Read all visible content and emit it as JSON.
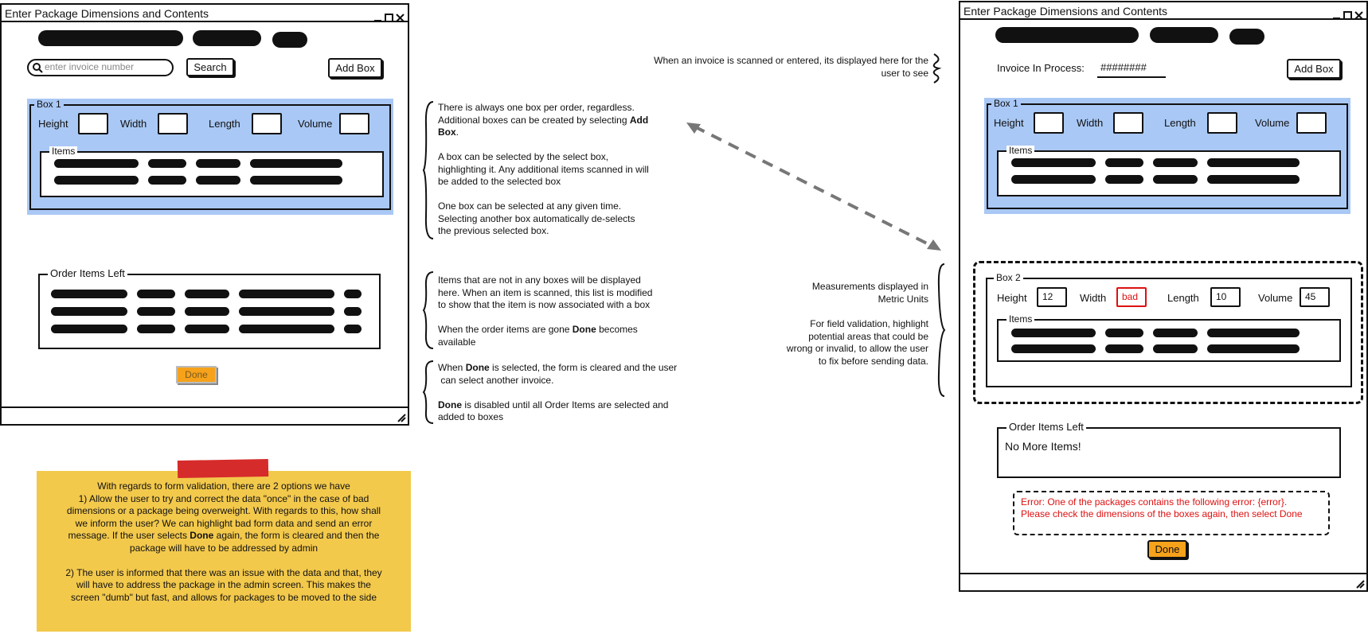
{
  "left_window": {
    "title": "Enter Package Dimensions and Contents",
    "search_placeholder": "enter invoice number",
    "search_button": "Search",
    "add_box_button": "Add Box",
    "box1": {
      "legend": "Box 1",
      "height_label": "Height",
      "width_label": "Width",
      "length_label": "Length",
      "volume_label": "Volume",
      "items_legend": "Items"
    },
    "order_items_legend": "Order Items Left",
    "done_button": "Done"
  },
  "right_window": {
    "title": "Enter Package Dimensions and Contents",
    "invoice_label": "Invoice In Process:",
    "invoice_value": "########",
    "add_box_button": "Add Box",
    "box1": {
      "legend": "Box 1",
      "height_label": "Height",
      "width_label": "Width",
      "length_label": "Length",
      "volume_label": "Volume",
      "items_legend": "Items"
    },
    "box2": {
      "legend": "Box 2",
      "height_label": "Height",
      "height_value": "12",
      "width_label": "Width",
      "width_value": "bad",
      "length_label": "Length",
      "length_value": "10",
      "volume_label": "Volume",
      "volume_value": "45",
      "items_legend": "Items"
    },
    "order_items_legend": "Order Items Left",
    "order_items_text": "No More Items!",
    "error_line1": "Error: One of the packages contains the following error: {error}.",
    "error_line2": "Please check the dimensions of the boxes again, then select Done",
    "done_button": "Done"
  },
  "notes": {
    "box_1": "There is always one box per order, regardless.",
    "box_2": "Additional boxes can be created by selecting",
    "box_2b": "Add",
    "box_3": "Box",
    "box_4": "A box can be selected by the select box,",
    "box_5": "highlighting it. Any additional items scanned in will",
    "box_6": "be added to the selected box",
    "box_7": "One box can be selected at any given time.",
    "box_8": "Selecting another box automatically de-selects",
    "box_9": "the previous selected box.",
    "items_1": "Items that are not in any boxes will be displayed",
    "items_2": "here. When an item is scanned, this list is modified",
    "items_3": "to show that the item is now associated with a box",
    "items_4": "When the order items are gone",
    "items_4b": "Done",
    "items_4c": "becomes",
    "items_5": "available",
    "done_1a": "When",
    "done_1b": "Done",
    "done_1c": "is selected, the form is cleared and the user",
    "done_2": "can select another invoice.",
    "done_3a": "Done",
    "done_3b": "is disabled until all Order Items are selected and",
    "done_4": "added to boxes",
    "invoice_1": "When an invoice is scanned or entered, its displayed here for the",
    "invoice_2": "user to see",
    "metric_1": "Measurements displayed in",
    "metric_2": "Metric Units",
    "valid_1": "For field validation, highlight",
    "valid_2": "potential areas that could be",
    "valid_3": "wrong or invalid, to allow the user",
    "valid_4": "to fix before sending data."
  },
  "sticky": {
    "line1": "With regards to form validation, there are 2 options we have",
    "line2": "1) Allow the user to try and correct the data \"once\" in the case of bad",
    "line3": "dimensions or a package being overweight. With regards to this, how shall",
    "line4": "we inform the user? We can highlight bad form data and send an error",
    "line5a": "message. If the user selects",
    "line5b": "Done",
    "line5c": "again, the form is cleared and then the",
    "line6": "package will have to be addressed by admin",
    "line7": "2) The user is informed that there was an issue with the data and that, they",
    "line8": "will have to address the package in the admin screen. This makes the",
    "line9": "screen \"dumb\" but fast, and allows for packages to be moved to the side"
  },
  "colors": {
    "selected_box": "#a9c8f5",
    "done_button": "#f7a21b",
    "error_text": "#dd1111",
    "sticky_note": "#f3c94c",
    "tape": "#d62b2b"
  }
}
